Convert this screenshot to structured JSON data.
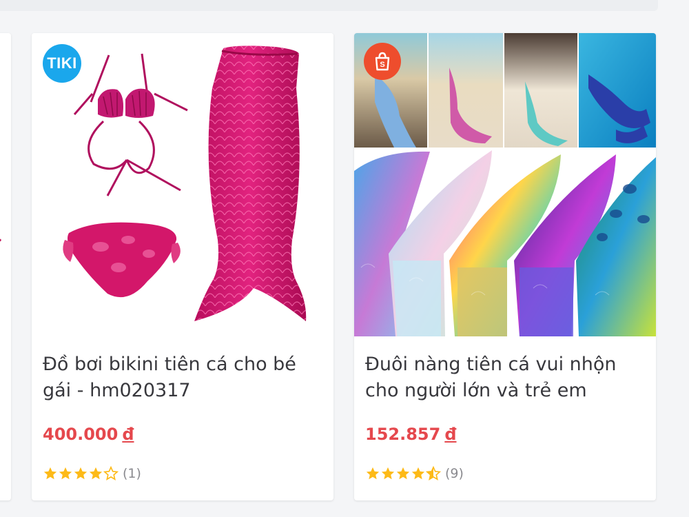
{
  "products": [
    {
      "store": "TIKI",
      "badge_text": "TIKI",
      "title": "Đồ bơi bikini tiên cá cho bé gái - hm020317",
      "price": "400.000",
      "currency": "đ",
      "rating": 4,
      "review_count": "(1)"
    },
    {
      "store": "Shopee",
      "badge_icon": "shopee-bag-icon",
      "title": "Đuôi nàng tiên cá vui nhộn cho người lớn và trẻ em",
      "price": "152.857",
      "currency": "đ",
      "rating": 4.5,
      "review_count": "(9)"
    }
  ],
  "colors": {
    "price": "#e5484d",
    "star": "#fdba18",
    "tiki": "#1aa7ec",
    "shopee": "#ee4d2d"
  }
}
